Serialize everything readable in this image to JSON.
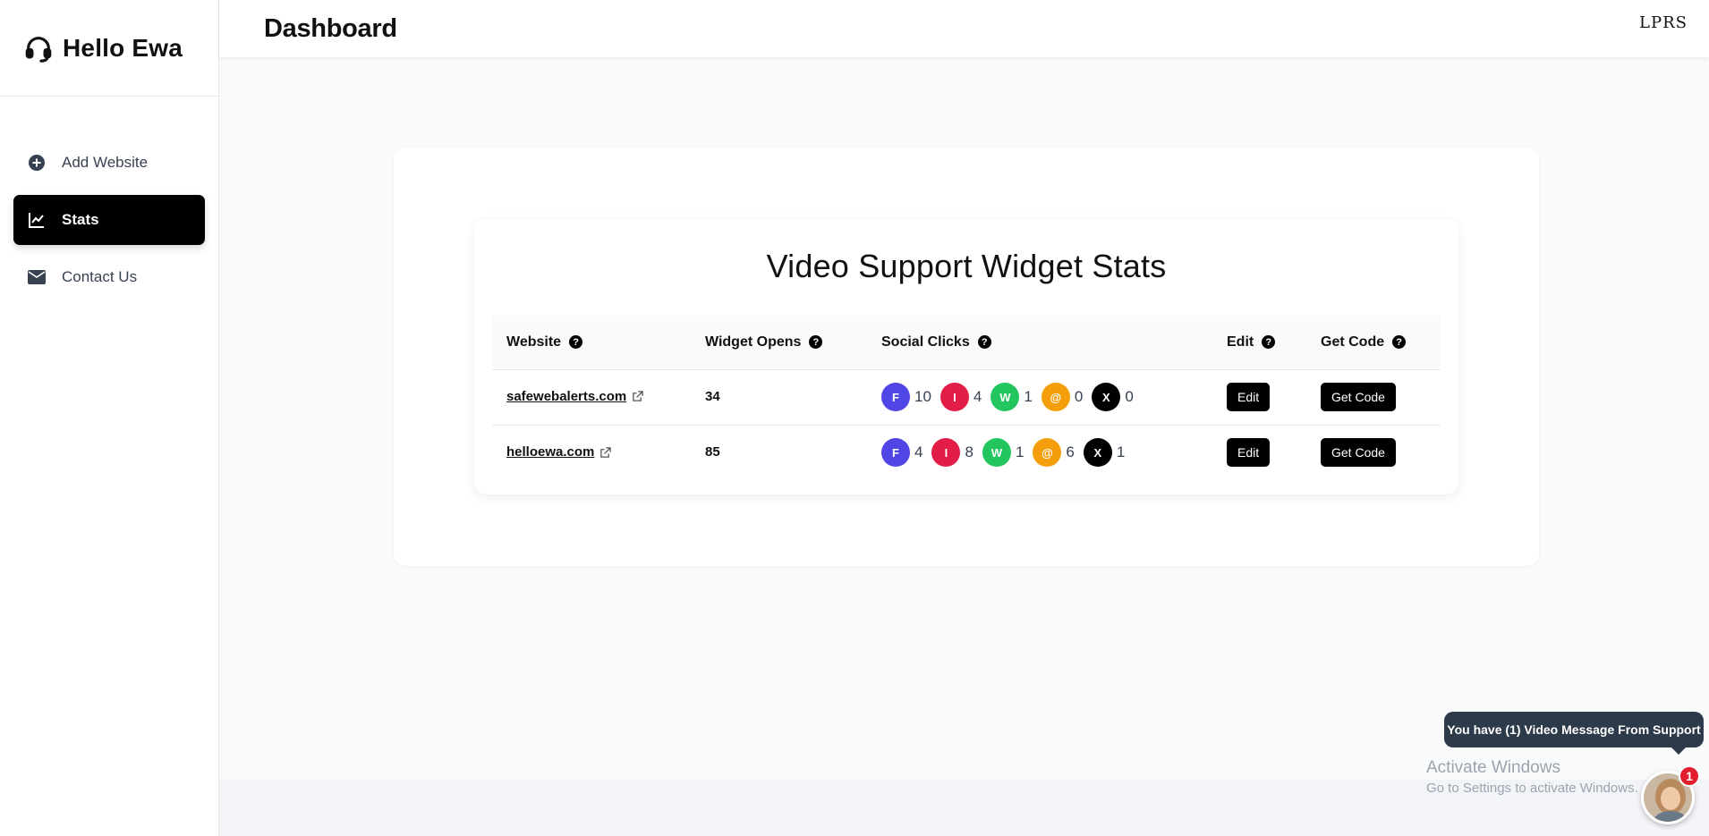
{
  "brand": {
    "name": "Hello Ewa",
    "icon": "headset-icon"
  },
  "sidebar": {
    "items": [
      {
        "label": "Add Website",
        "icon": "plus-circle-icon",
        "active": false
      },
      {
        "label": "Stats",
        "icon": "line-chart-icon",
        "active": true
      },
      {
        "label": "Contact Us",
        "icon": "envelope-icon",
        "active": false
      }
    ]
  },
  "header": {
    "title": "Dashboard",
    "right_text": "LPRS"
  },
  "stats_card": {
    "title": "Video Support Widget Stats",
    "columns": [
      "Website",
      "Widget Opens",
      "Social Clicks",
      "Edit",
      "Get Code"
    ],
    "rows": [
      {
        "website": "safewebalerts.com",
        "opens": "34",
        "socials": [
          {
            "letter": "F",
            "count": "10",
            "color": "#4f46e5"
          },
          {
            "letter": "I",
            "count": "4",
            "color": "#e11d48"
          },
          {
            "letter": "W",
            "count": "1",
            "color": "#22c55e"
          },
          {
            "letter": "@",
            "count": "0",
            "color": "#f59e0b"
          },
          {
            "letter": "X",
            "count": "0",
            "color": "#000000"
          }
        ],
        "edit_label": "Edit",
        "code_label": "Get Code"
      },
      {
        "website": "helloewa.com",
        "opens": "85",
        "socials": [
          {
            "letter": "F",
            "count": "4",
            "color": "#4f46e5"
          },
          {
            "letter": "I",
            "count": "8",
            "color": "#e11d48"
          },
          {
            "letter": "W",
            "count": "1",
            "color": "#22c55e"
          },
          {
            "letter": "@",
            "count": "6",
            "color": "#f59e0b"
          },
          {
            "letter": "X",
            "count": "1",
            "color": "#000000"
          }
        ],
        "edit_label": "Edit",
        "code_label": "Get Code"
      }
    ]
  },
  "support_widget": {
    "message": "You have (1) Video Message From Support",
    "badge_count": "1"
  },
  "windows_watermark": {
    "title": "Activate Windows",
    "subtitle": "Go to Settings to activate Windows."
  }
}
